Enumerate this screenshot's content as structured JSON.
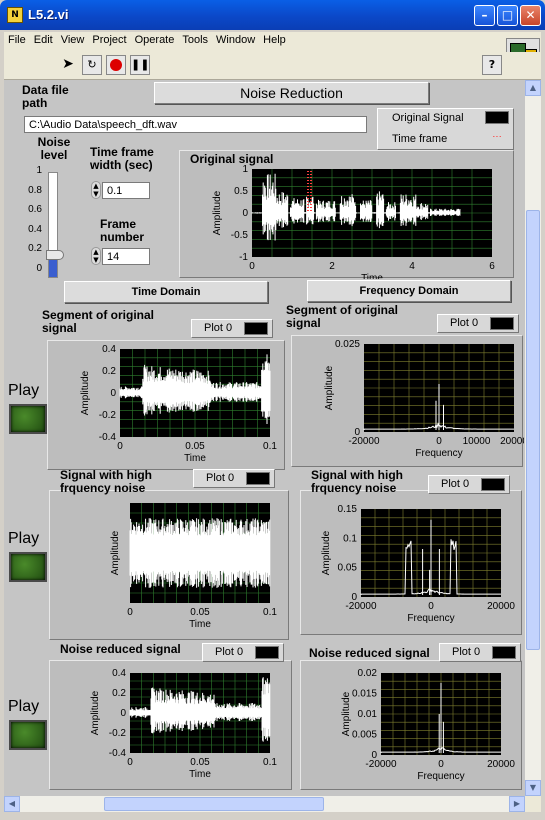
{
  "window": {
    "title": "L5.2.vi",
    "app_icon_text": "N"
  },
  "menu": [
    "File",
    "Edit",
    "View",
    "Project",
    "Operate",
    "Tools",
    "Window",
    "Help"
  ],
  "toolbar": {
    "help_glyph": "?"
  },
  "header": {
    "title": "Noise Reduction",
    "file_path_label": "Data file path",
    "file_path_value": "C:\\Audio Data\\speech_dft.wav"
  },
  "main_legend": [
    {
      "name": "Original Signal"
    },
    {
      "name": "Time frame"
    }
  ],
  "noise": {
    "label": "Noise level",
    "ticks": [
      "1",
      "0.8",
      "0.6",
      "0.4",
      "0.2",
      "0"
    ],
    "value": 0.2
  },
  "frame_width": {
    "label": "Time frame width (sec)",
    "value": "0.1"
  },
  "frame_number": {
    "label": "Frame number",
    "value": "14"
  },
  "tabs": {
    "time": "Time Domain",
    "freq": "Frequency Domain"
  },
  "play": [
    "Play",
    "Play",
    "Play"
  ],
  "colors": {
    "trace": "#ffffff",
    "timeframe": "#ff4040",
    "grid_time": "#2f7f2f",
    "grid_freq": "#7f7f2f",
    "panel": "#c5c5c5"
  },
  "chart_data": [
    {
      "id": "original",
      "type": "line",
      "title": "Original signal",
      "xlabel": "Time",
      "ylabel": "Amplitude",
      "xlim": [
        0,
        6
      ],
      "ylim": [
        -1,
        1
      ],
      "xticks": [
        "0",
        "2",
        "4",
        "6"
      ],
      "yticks": [
        "1",
        "0.5",
        "0",
        "-0.5",
        "-1"
      ],
      "series": [
        {
          "name": "Original Signal"
        },
        {
          "name": "Time frame",
          "x": [
            1.4,
            1.4
          ]
        }
      ]
    },
    {
      "id": "seg_time",
      "type": "line",
      "title": "Segment of original signal",
      "legend": "Plot 0",
      "xlabel": "Time",
      "ylabel": "Amplitude",
      "xlim": [
        0,
        0.1
      ],
      "ylim": [
        -0.4,
        0.4
      ],
      "xticks": [
        "0",
        "0.05",
        "0.1"
      ],
      "yticks": [
        "0.4",
        "0.2",
        "0",
        "-0.2",
        "-0.4"
      ]
    },
    {
      "id": "seg_freq",
      "type": "line",
      "title": "Segment of original signal",
      "legend": "Plot 0",
      "xlabel": "Frequency",
      "ylabel": "Amplitude",
      "xlim": [
        -20000,
        20000
      ],
      "ylim": [
        0,
        0.025
      ],
      "xticks": [
        "-20000",
        "0",
        "10000",
        "20000"
      ],
      "yticks": [
        "0.025",
        "0"
      ]
    },
    {
      "id": "noise_time",
      "type": "line",
      "title": "Signal with high frquency noise",
      "legend": "Plot 0",
      "xlabel": "Time",
      "ylabel": "Amplitude",
      "xlim": [
        0,
        0.1
      ],
      "ylim": [
        -1,
        1
      ],
      "xticks": [
        "0",
        "0.05",
        "0.1"
      ],
      "yticks": []
    },
    {
      "id": "noise_freq",
      "type": "line",
      "title": "Signal with high frquency noise",
      "legend": "Plot 0",
      "xlabel": "Frequency",
      "ylabel": "Amplitude",
      "xlim": [
        -20000,
        20000
      ],
      "ylim": [
        0,
        0.15
      ],
      "xticks": [
        "-20000",
        "0",
        "20000"
      ],
      "yticks": [
        "0.15",
        "0.1",
        "0.05",
        "0"
      ]
    },
    {
      "id": "red_time",
      "type": "line",
      "title": "Noise reduced signal",
      "legend": "Plot 0",
      "xlabel": "Time",
      "ylabel": "Amplitude",
      "xlim": [
        0,
        0.1
      ],
      "ylim": [
        -0.4,
        0.4
      ],
      "xticks": [
        "0",
        "0.05",
        "0.1"
      ],
      "yticks": [
        "0.4",
        "0.2",
        "0",
        "-0.2",
        "-0.4"
      ]
    },
    {
      "id": "red_freq",
      "type": "line",
      "title": "Noise reduced signal",
      "legend": "Plot 0",
      "xlabel": "Frequency",
      "ylabel": "Amplitude",
      "xlim": [
        -20000,
        20000
      ],
      "ylim": [
        0,
        0.02
      ],
      "xticks": [
        "-20000",
        "0",
        "20000"
      ],
      "yticks": [
        "0.02",
        "0.015",
        "0.01",
        "0.005",
        "0"
      ]
    }
  ]
}
